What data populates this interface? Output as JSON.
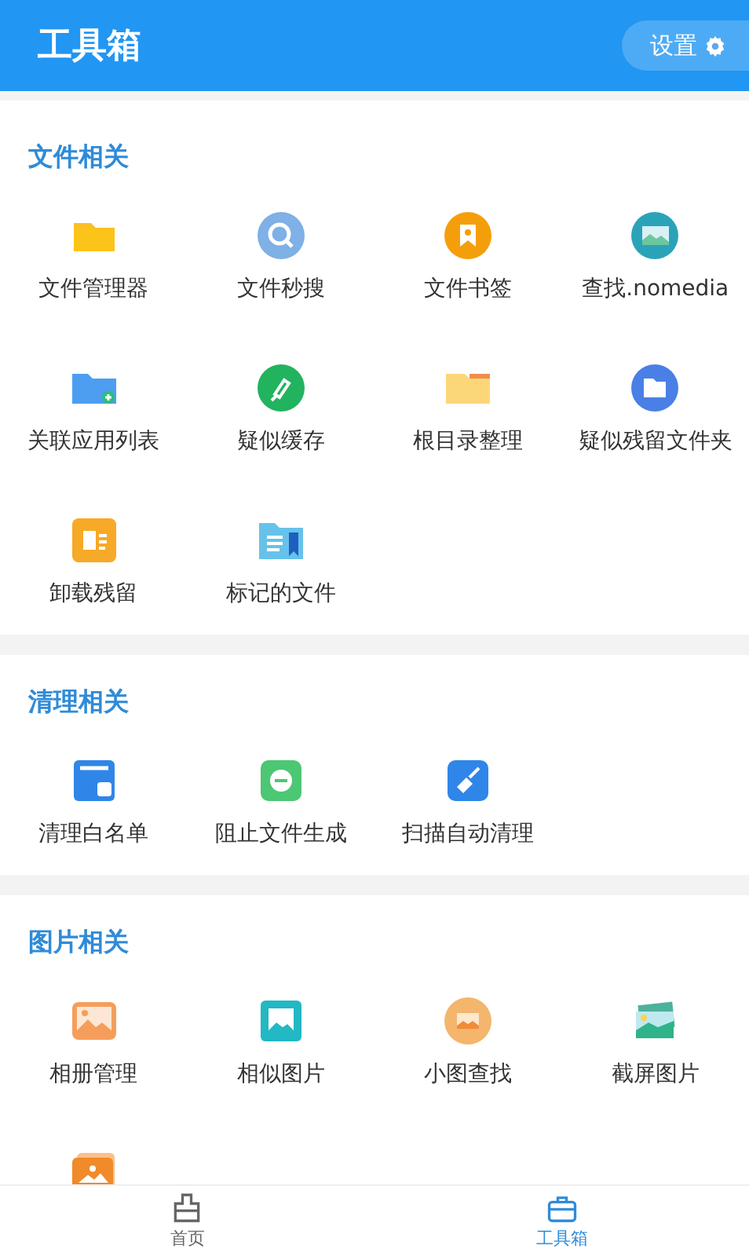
{
  "header": {
    "title": "工具箱",
    "settings_button": "设置"
  },
  "sections": [
    {
      "title": "文件相关",
      "items": [
        {
          "label": "文件管理器"
        },
        {
          "label": "文件秒搜"
        },
        {
          "label": "文件书签"
        },
        {
          "label": "查找.nomedia"
        },
        {
          "label": "关联应用列表"
        },
        {
          "label": "疑似缓存"
        },
        {
          "label": "根目录整理"
        },
        {
          "label": "疑似残留文件夹"
        },
        {
          "label": "卸载残留"
        },
        {
          "label": "标记的文件"
        }
      ]
    },
    {
      "title": "清理相关",
      "items": [
        {
          "label": "清理白名单"
        },
        {
          "label": "阻止文件生成"
        },
        {
          "label": "扫描自动清理"
        }
      ]
    },
    {
      "title": "图片相关",
      "items": [
        {
          "kind": "tool",
          "label": "相册管理"
        },
        {
          "kind": "tool",
          "label": "相似图片"
        },
        {
          "kind": "tool",
          "label": "小图查找"
        },
        {
          "kind": "tool",
          "label": "截屏图片"
        },
        {
          "kind": "icon_only"
        }
      ]
    }
  ],
  "bottom_nav": [
    {
      "label": "首页",
      "selected": false
    },
    {
      "label": "工具箱",
      "selected": true
    }
  ]
}
